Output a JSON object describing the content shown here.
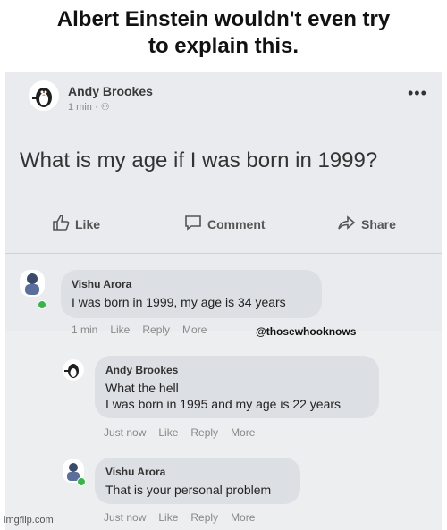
{
  "caption": {
    "line1": "Albert Einstein wouldn't even try",
    "line2": "to explain this."
  },
  "post": {
    "author": "Andy Brookes",
    "time": "1 min · ",
    "text": "What is my age if I was born in 1999?",
    "actions": {
      "like": "Like",
      "comment": "Comment",
      "share": "Share"
    }
  },
  "comments": [
    {
      "author": "Vishu Arora",
      "text": "I was born in 1999, my age is 34 years",
      "meta": [
        "1 min",
        "Like",
        "Reply",
        "More"
      ]
    },
    {
      "author": "Andy Brookes",
      "line1": "What the hell",
      "line2": "I was born in 1995 and my age is 22 years",
      "meta": [
        "Just now",
        "Like",
        "Reply",
        "More"
      ]
    },
    {
      "author": "Vishu Arora",
      "text": "That is your personal problem",
      "meta": [
        "Just now",
        "Like",
        "Reply",
        "More"
      ]
    }
  ],
  "watermark": "@thosewhooknows",
  "imgflip": "imgflip.com",
  "icons": [
    "penguin-avatar-icon",
    "user-avatar-icon",
    "thumbs-up-icon",
    "comment-icon",
    "share-icon",
    "more-icon",
    "friends-icon"
  ],
  "colors": {
    "online": "#3bb34a",
    "bubble": "#dcdfe3",
    "post_bg": "#e9ebee"
  }
}
